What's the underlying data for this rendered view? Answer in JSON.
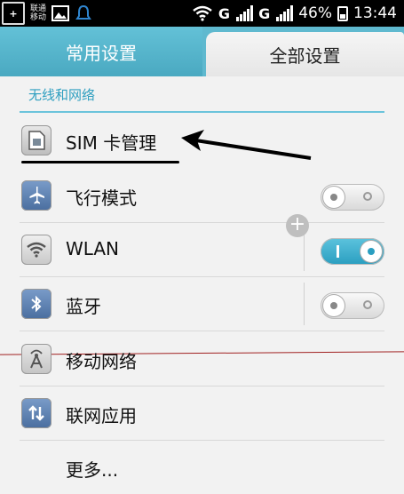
{
  "status_bar": {
    "carrier_badge": "联通",
    "carrier_line1": "联通",
    "carrier_line2": "移动",
    "net1": "G",
    "net2": "G",
    "battery_percent": "46%",
    "time": "13:44",
    "icons": [
      "image-icon",
      "notification-bell-icon",
      "wifi-icon",
      "signal-icon",
      "signal-icon",
      "battery-icon"
    ]
  },
  "tabs": [
    {
      "label": "常用设置",
      "active": false
    },
    {
      "label": "全部设置",
      "active": true
    }
  ],
  "section": {
    "header": "无线和网络"
  },
  "items": [
    {
      "label": "SIM 卡管理",
      "icon": "sim-card-icon"
    },
    {
      "label": "飞行模式",
      "icon": "airplane-icon",
      "toggle": "off"
    },
    {
      "label": "WLAN",
      "icon": "wifi-icon",
      "toggle": "on"
    },
    {
      "label": "蓝牙",
      "icon": "bluetooth-icon",
      "toggle": "off"
    },
    {
      "label": "移动网络",
      "icon": "antenna-icon"
    },
    {
      "label": "联网应用",
      "icon": "data-transfer-icon"
    },
    {
      "label": "更多..."
    }
  ],
  "colors": {
    "accent": "#5fb9cf",
    "section_text": "#2f9fc0"
  }
}
